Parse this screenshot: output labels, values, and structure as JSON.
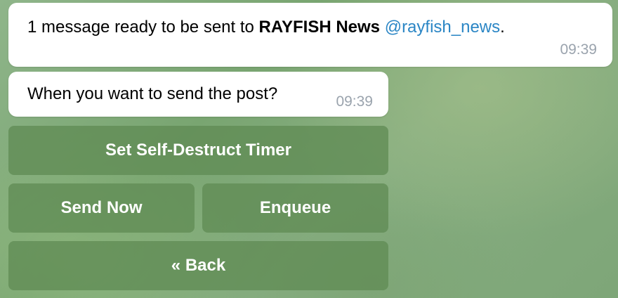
{
  "messages": [
    {
      "prefix": "1 message ready to be sent to ",
      "channel_name": "RAYFISH News",
      "mention": "@rayfish_news",
      "suffix": ".",
      "time": "09:39"
    },
    {
      "text": "When you want to send the post?",
      "time": "09:39"
    }
  ],
  "keyboard": {
    "self_destruct": "Set Self-Destruct Timer",
    "send_now": "Send Now",
    "enqueue": "Enqueue",
    "back": "« Back"
  },
  "colors": {
    "mention": "#2b86c5",
    "button_bg": "#608c54",
    "time": "#9aa3ad"
  }
}
